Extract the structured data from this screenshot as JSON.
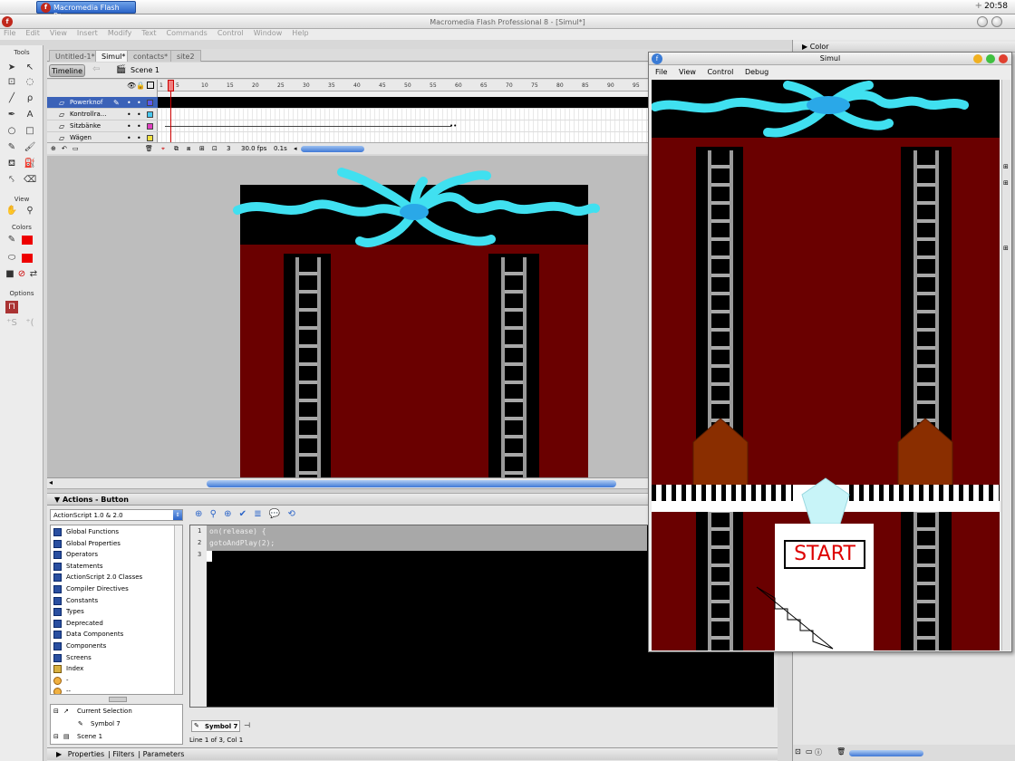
{
  "os": {
    "taskbar_button": "Macromedia Flash Pr...",
    "clock": "20:58",
    "clock_extra": "+"
  },
  "window": {
    "title": "Macromedia Flash Professional 8 - [Simul*]"
  },
  "menu": [
    "File",
    "Edit",
    "View",
    "Insert",
    "Modify",
    "Text",
    "Commands",
    "Control",
    "Window",
    "Help"
  ],
  "tools": {
    "title": "Tools",
    "view_label": "View",
    "colors_label": "Colors",
    "options_label": "Options"
  },
  "doc_tabs": [
    "Untitled-1*",
    "Simul*",
    "contacts*",
    "site2"
  ],
  "timeline": {
    "button": "Timeline",
    "scene": "Scene 1",
    "ruler": [
      "1",
      "5",
      "10",
      "15",
      "20",
      "25",
      "30",
      "35",
      "40",
      "45",
      "50",
      "55",
      "60",
      "65",
      "70",
      "75",
      "80",
      "85",
      "90",
      "95"
    ],
    "layers": [
      {
        "name": "Powerknof",
        "color": "#5a5af0"
      },
      {
        "name": "Kontrollra...",
        "color": "#48c8f0"
      },
      {
        "name": "Sitzbänke",
        "color": "#e040c0"
      },
      {
        "name": "Wägen",
        "color": "#f0e040"
      }
    ],
    "current_frame": "3",
    "fps": "30.0 fps",
    "elapsed": "0.1s"
  },
  "actions": {
    "panel_title": "Actions - Button",
    "version_select": "ActionScript 1.0 & 2.0",
    "categories": [
      "Global Functions",
      "Global Properties",
      "Operators",
      "Statements",
      "ActionScript 2.0 Classes",
      "Compiler Directives",
      "Constants",
      "Types",
      "Deprecated",
      "Data Components",
      "Components",
      "Screens",
      "Index",
      "-",
      "--"
    ],
    "selection_tree": [
      "Current Selection",
      "Symbol 7",
      "Scene 1"
    ],
    "code": [
      "on(release)  {",
      "gotoAndPlay(2);",
      ""
    ],
    "line_numbers": [
      "1",
      "2",
      "3"
    ],
    "symbol_tab": "Symbol 7",
    "status": "Line 1 of 3, Col 1"
  },
  "properties_tabs": [
    "Properties",
    "Filters",
    "Parameters"
  ],
  "right_panel": {
    "color_header": "Color"
  },
  "player": {
    "title": "Simul",
    "menu": [
      "File",
      "View",
      "Control",
      "Debug"
    ],
    "start_label": "START"
  },
  "colors": {
    "stage_red": "#6a0000",
    "cyan": "#40e0f0",
    "selection_blue": "#3b62b8"
  }
}
